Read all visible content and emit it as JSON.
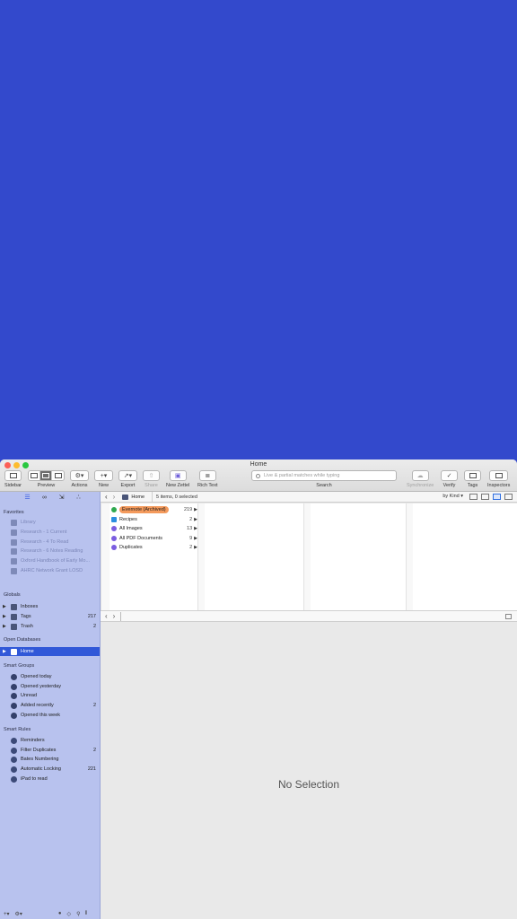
{
  "window": {
    "title": "Home"
  },
  "toolbar": {
    "sidebar_label": "Sidebar",
    "preview_label": "Preview",
    "actions_label": "Actions",
    "new_label": "New",
    "export_label": "Export",
    "share_label": "Share",
    "new_zettel_label": "New Zettel",
    "rich_text_label": "Rich Text",
    "search_placeholder": "Live & partial matches while typing",
    "search_label": "Search",
    "synchronize_label": "Synchronize",
    "verify_label": "Verify",
    "tags_label": "Tags",
    "inspectors_label": "Inspectors"
  },
  "sidebar": {
    "favorites_heading": "Favorites",
    "favorites": [
      {
        "label": "Library"
      },
      {
        "label": "Research - 1 Current"
      },
      {
        "label": "Research - 4 To Read"
      },
      {
        "label": "Research - 6 Notes Reading"
      },
      {
        "label": "Oxford Handbook of Early Mo..."
      },
      {
        "label": "AHRC Network Grant LOSD"
      }
    ],
    "globals_heading": "Globals",
    "globals": [
      {
        "label": "Inboxes",
        "count": ""
      },
      {
        "label": "Tags",
        "count": "217"
      },
      {
        "label": "Trash",
        "count": "2"
      }
    ],
    "open_db_heading": "Open Databases",
    "open_dbs": [
      {
        "label": "Home"
      }
    ],
    "smart_groups_heading": "Smart Groups",
    "smart_groups": [
      {
        "label": "Opened today",
        "count": ""
      },
      {
        "label": "Opened yesterday",
        "count": ""
      },
      {
        "label": "Unread",
        "count": ""
      },
      {
        "label": "Added recently",
        "count": "2"
      },
      {
        "label": "Opened this week",
        "count": ""
      }
    ],
    "smart_rules_heading": "Smart Rules",
    "smart_rules": [
      {
        "label": "Reminders",
        "count": ""
      },
      {
        "label": "Filter Duplicates",
        "count": "2"
      },
      {
        "label": "Bates Numbering",
        "count": ""
      },
      {
        "label": "Automatic Locking",
        "count": "221"
      },
      {
        "label": "iPad to read",
        "count": ""
      }
    ]
  },
  "navbar": {
    "breadcrumb": "Home",
    "status": "5 items, 0 selected",
    "sort": "by Kind"
  },
  "browser": {
    "items": [
      {
        "label": "Evernote (Archived)",
        "count": "219",
        "icon": "evernote-icon"
      },
      {
        "label": "Recipes",
        "count": "2",
        "icon": "notebook-icon"
      },
      {
        "label": "All Images",
        "count": "13",
        "icon": "smart-group-icon"
      },
      {
        "label": "All PDF Documents",
        "count": "9",
        "icon": "smart-group-icon"
      },
      {
        "label": "Duplicates",
        "count": "2",
        "icon": "smart-group-icon"
      }
    ]
  },
  "preview": {
    "empty_text": "No Selection"
  },
  "colors": {
    "desktop": "#3349cc",
    "sidebar": "#b8c2ee",
    "selection": "#3158d8",
    "highlight": "#f49a5c"
  }
}
